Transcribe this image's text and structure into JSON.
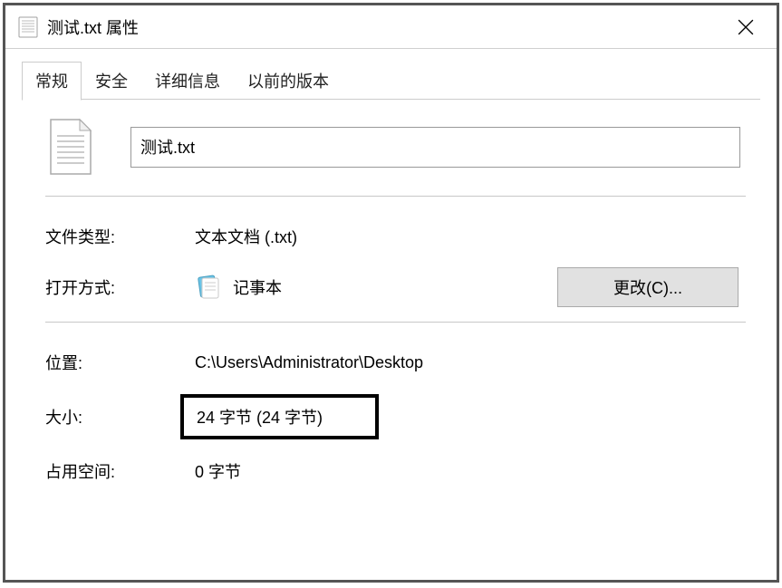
{
  "titlebar": {
    "title": "测试.txt 属性"
  },
  "tabs": {
    "general": "常规",
    "security": "安全",
    "details": "详细信息",
    "previous": "以前的版本"
  },
  "filename": {
    "value": "测试.txt"
  },
  "filetype": {
    "label": "文件类型:",
    "value": "文本文档 (.txt)"
  },
  "openwith": {
    "label": "打开方式:",
    "app": "记事本",
    "change_button": "更改(C)..."
  },
  "location": {
    "label": "位置:",
    "value": "C:\\Users\\Administrator\\Desktop"
  },
  "size": {
    "label": "大小:",
    "value": "24 字节 (24 字节)"
  },
  "size_on_disk": {
    "label": "占用空间:",
    "value": "0 字节"
  },
  "icons": {
    "file_small": "document-icon",
    "file_large": "document-icon",
    "notepad": "notepad-icon"
  }
}
